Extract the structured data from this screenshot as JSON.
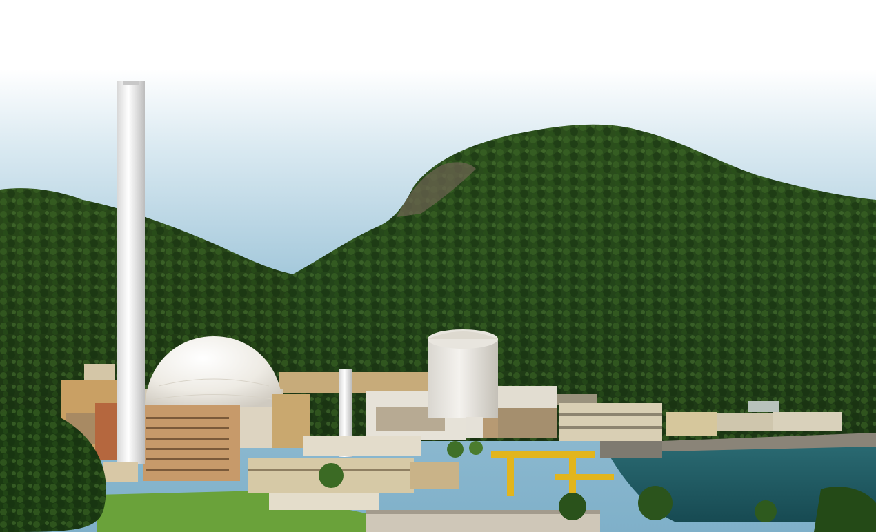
{
  "scene": {
    "description_id": "nuclear-power-plant-coastal-hillside",
    "colors": {
      "sky_top": "#ffffff",
      "sky_mid": "#cfe3ee",
      "sky_horizon": "#7fb3cf",
      "forest_dark": "#1f3a14",
      "forest_mid": "#2f5a1f",
      "forest_light": "#4f7a32",
      "dome": "#f1efe9",
      "building_tan": "#c9b48c",
      "building_brick": "#b86a45",
      "water": "#1f5a63",
      "lawn": "#6aa23a",
      "crane_yellow": "#e2b51d"
    }
  }
}
